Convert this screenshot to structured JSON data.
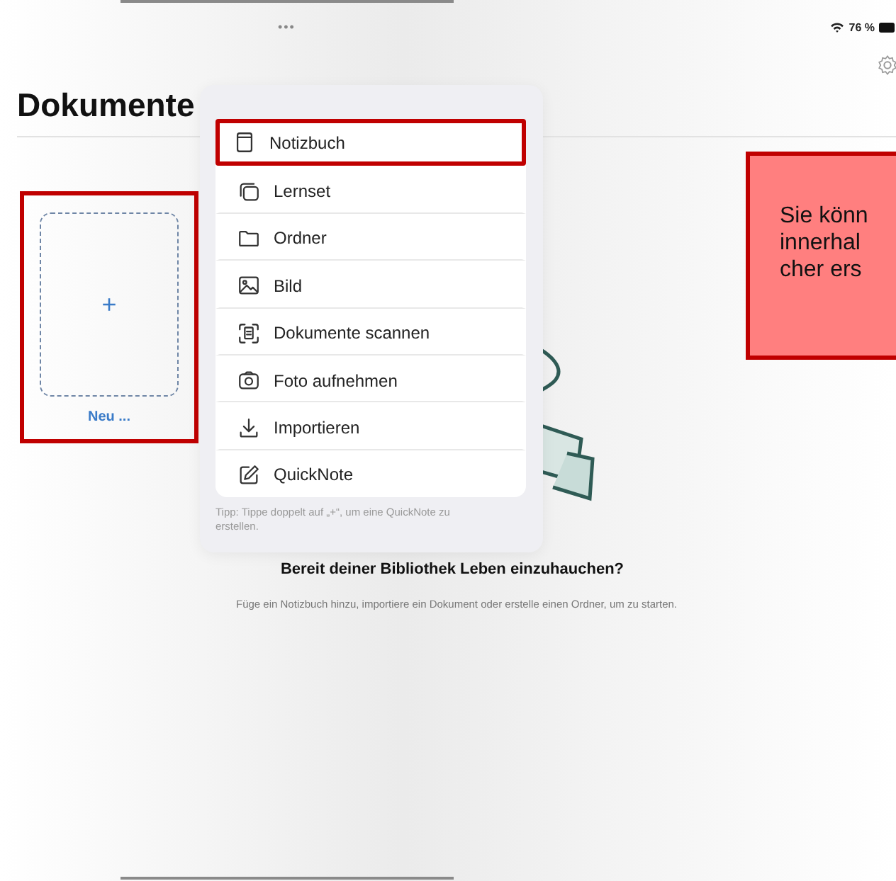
{
  "status_bar": {
    "dots": "•••",
    "battery": "76 %"
  },
  "title": "Dokumente",
  "new_card": {
    "plus": "+",
    "label": "Neu ...",
    "annotated": true
  },
  "menu": {
    "items": [
      {
        "label": "Notizbuch",
        "annotated": true
      },
      {
        "label": "Lernset",
        "annotated": false
      },
      {
        "label": "Ordner",
        "annotated": false
      },
      {
        "label": "Bild",
        "annotated": false
      },
      {
        "label": "Dokumente scannen",
        "annotated": false
      },
      {
        "label": "Foto aufnehmen",
        "annotated": false
      },
      {
        "label": "Importieren",
        "annotated": false
      },
      {
        "label": "QuickNote",
        "annotated": false
      }
    ],
    "tip": "Tipp: Tippe doppelt auf „+“, um eine QuickNote zu erstellen."
  },
  "empty_state": {
    "heading": "Bereit deiner Bibliothek Leben einzuhauchen?",
    "text": "Füge ein Notizbuch hinzu, importiere ein Dokument oder erstelle einen Ordner, um zu starten."
  },
  "callout": {
    "lines": [
      "Sie könn",
      "innerhal",
      "cher ers"
    ]
  }
}
